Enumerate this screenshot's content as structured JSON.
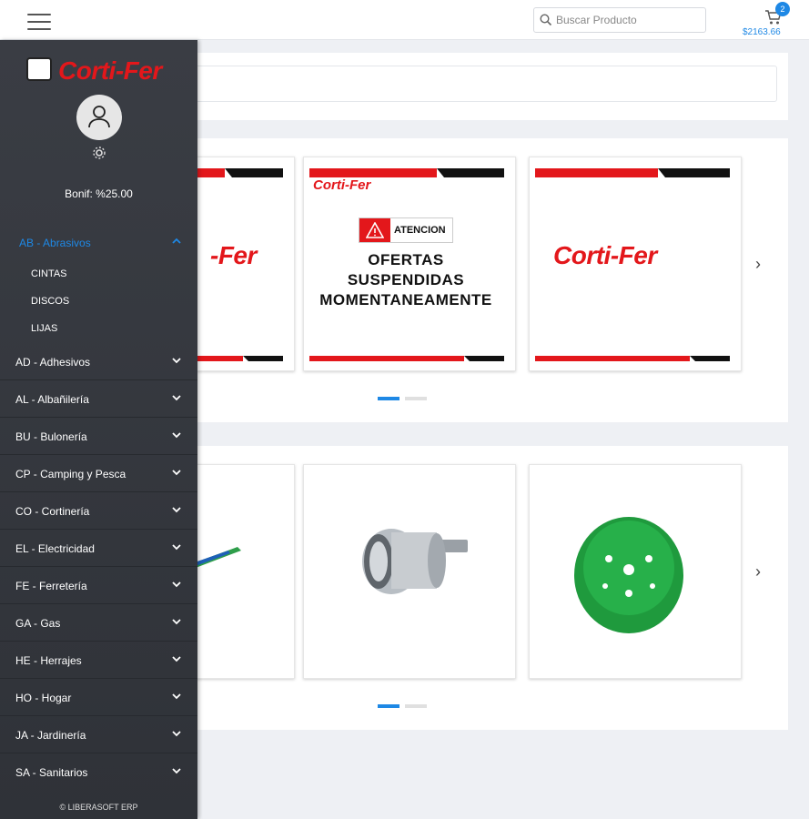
{
  "header": {
    "search_placeholder": "Buscar Producto",
    "cart_count": "2",
    "cart_total": "$2163.66"
  },
  "sidebar": {
    "logo_text": "Corti-Fer",
    "bonif": "Bonif: %25.00",
    "open_category": "AB - Abrasivos",
    "subitems": [
      "CINTAS",
      "DISCOS",
      "LIJAS"
    ],
    "categories": [
      "AD - Adhesivos",
      "AL - Albañilería",
      "BU - Bulonería",
      "CP - Camping y Pesca",
      "CO - Cortinería",
      "EL - Electricidad",
      "FE - Ferretería",
      "GA - Gas",
      "HE - Herrajes",
      "HO - Hogar",
      "JA - Jardinería",
      "SA - Sanitarios"
    ],
    "footer": "© LIBERASOFT ERP"
  },
  "banners": {
    "partial_brand": "-Fer",
    "brand": "Corti-Fer",
    "alert_label": "ATENCION",
    "offer_lines": [
      "OFERTAS",
      "SUSPENDIDAS",
      "MOMENTANEAMENTE"
    ]
  },
  "colors": {
    "accent": "#1e88e5",
    "brand_red": "#e3171b",
    "sidebar_bg": "#34373d"
  }
}
